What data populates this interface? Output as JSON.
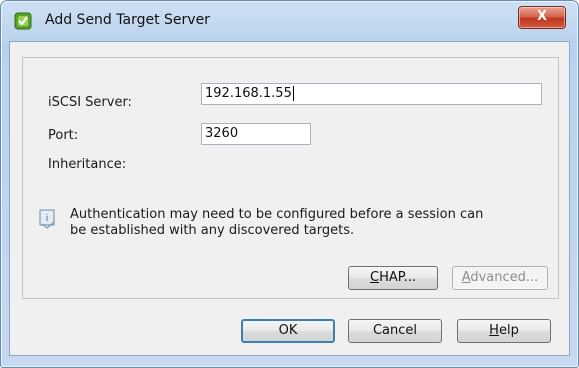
{
  "window": {
    "title": "Add Send Target Server",
    "close_glyph": "X",
    "icon": "vsphere-app-icon"
  },
  "form": {
    "server_label": "iSCSI Server:",
    "server_value": "192.168.1.55",
    "port_label": "Port:",
    "port_value": "3260",
    "inheritance_label": "Inheritance:"
  },
  "info": {
    "icon": "info-icon",
    "line1": "Authentication may need to be configured before a session can",
    "line2": "be established with any discovered targets."
  },
  "pane_buttons": {
    "chap_mnemonic": "C",
    "chap_rest": "HAP...",
    "advanced_mnemonic": "A",
    "advanced_rest": "dvanced..."
  },
  "footer": {
    "ok_label": "OK",
    "cancel_label": "Cancel",
    "help_mnemonic": "H",
    "help_rest": "elp"
  },
  "colors": {
    "titlebar": "#b9d1ec",
    "close_button": "#c0381e",
    "dialog_background": "#f0f0f0"
  }
}
